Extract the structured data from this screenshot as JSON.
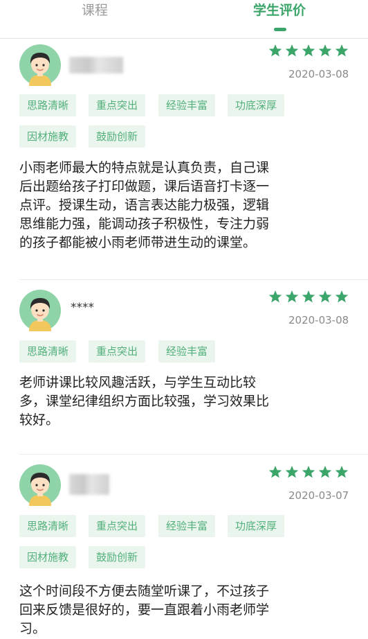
{
  "tabs": [
    {
      "label": "课程",
      "active": false
    },
    {
      "label": "学生评价",
      "active": true
    }
  ],
  "colors": {
    "accent": "#3ca66a",
    "star": "#3ca66a",
    "tag_bg": "#eaf5ee",
    "tag_text": "#52b07a"
  },
  "reviews": [
    {
      "user_name": "",
      "name_redacted": true,
      "rating": 5,
      "date": "2020-03-08",
      "tags": [
        "思路清晰",
        "重点突出",
        "经验丰富",
        "功底深厚",
        "因材施教",
        "鼓励创新"
      ],
      "text": "小雨老师最大的特点就是认真负责，自己课\n后出题给孩子打印做题，课后语音打卡逐一\n点评。授课生动，语言表达能力极强，逻辑\n思维能力强，能调动孩子积极性，专注力弱\n的孩子都能被小雨老师带进生动的课堂。"
    },
    {
      "user_name": "****",
      "name_redacted": false,
      "rating": 5,
      "date": "2020-03-08",
      "tags": [
        "思路清晰",
        "重点突出",
        "经验丰富"
      ],
      "text": "老师讲课比较风趣活跃，与学生互动比较\n多，课堂纪律组织方面比较强，学习效果比\n较好。"
    },
    {
      "user_name": "",
      "name_redacted": true,
      "rating": 5,
      "date": "2020-03-07",
      "tags": [
        "思路清晰",
        "重点突出",
        "经验丰富",
        "功底深厚",
        "因材施教",
        "鼓励创新"
      ],
      "text": "这个时间段不方便去随堂听课了，不过孩子\n回来反馈是很好的，要一直跟着小雨老师学\n习。"
    }
  ]
}
